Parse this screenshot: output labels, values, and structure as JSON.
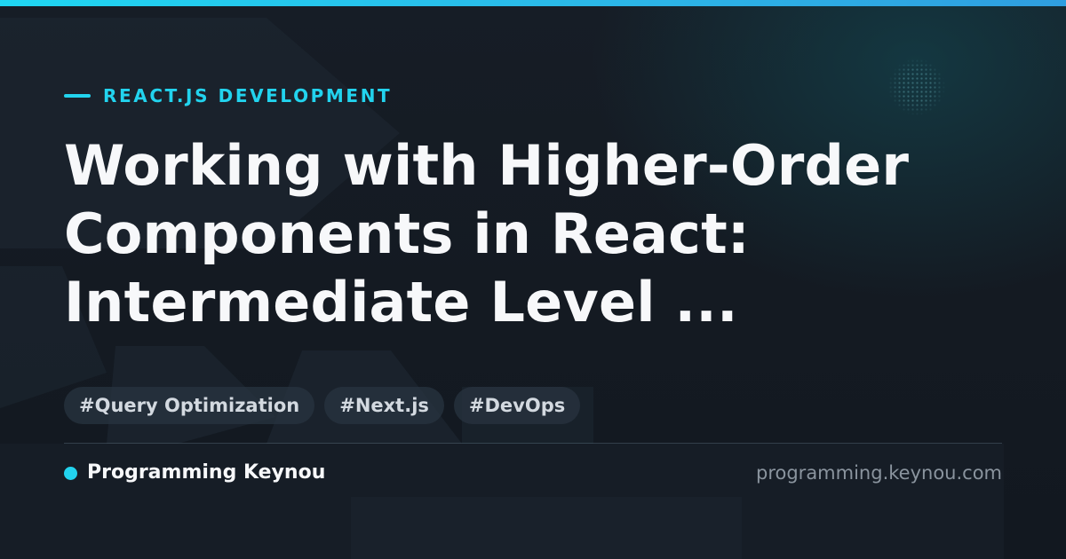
{
  "header": {
    "category": "REACT.JS DEVELOPMENT"
  },
  "title": {
    "line1": "Working with Higher-Order",
    "line2": "Components in React:",
    "line3": "Intermediate Level ..."
  },
  "tags": [
    {
      "label": "#Query Optimization"
    },
    {
      "label": "#Next.js"
    },
    {
      "label": "#DevOps"
    }
  ],
  "footer": {
    "brand_name": "Programming Keynou",
    "domain": "programming.keynou.com"
  },
  "colors": {
    "accent": "#22d3ee",
    "background": "#141a22",
    "title_text": "#f7f8fa",
    "tag_background": "#283440",
    "muted_text": "#8a949e"
  }
}
